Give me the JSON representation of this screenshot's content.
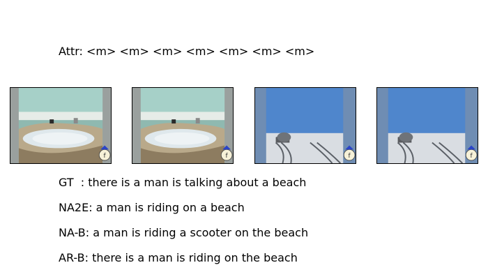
{
  "attr_line": "Attr: <m> <m> <m> <m> <m> <m> <m>",
  "captions": {
    "gt": "GT  : there is a man is talking about a beach",
    "na2e": "NA2E: a man is riding on a beach",
    "na_b": "NA-B: a man is riding a scooter on the beach",
    "ar_b": "AR-B: there is a man is riding on the beach"
  },
  "frames": [
    {
      "scene": "coastal-lagoon",
      "sky": "#9cc9c4"
    },
    {
      "scene": "coastal-lagoon",
      "sky": "#9cc9c4"
    },
    {
      "scene": "salt-flat-with-tracks",
      "sky": "#4a7fc4"
    },
    {
      "scene": "salt-flat-with-tracks",
      "sky": "#4a7fc4"
    }
  ],
  "watermark_icon": "channel-logo-icon"
}
